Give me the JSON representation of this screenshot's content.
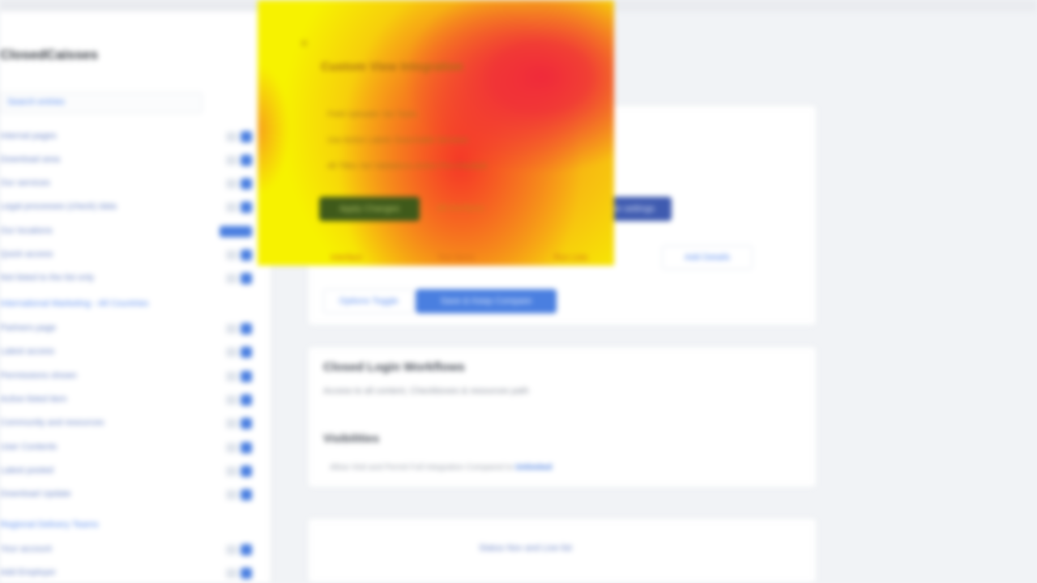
{
  "sidebar": {
    "title": "ClosedCaisses",
    "search_placeholder": "Search entries",
    "sections": [
      {
        "label": "International Marketing - All Countries"
      },
      {
        "label": "Regional Delivery Teams"
      }
    ],
    "items": [
      {
        "label": "Internal pages"
      },
      {
        "label": "Download area"
      },
      {
        "label": "Our services"
      },
      {
        "label": "Legal processes (check) data"
      },
      {
        "label": "Our locations"
      },
      {
        "label": "Quick access"
      },
      {
        "label": "Not listed to the list only"
      },
      {
        "label": "Partners page"
      },
      {
        "label": "Latest access"
      },
      {
        "label": "Permissions shown"
      },
      {
        "label": "Active listed item"
      },
      {
        "label": "Community and resources"
      },
      {
        "label": "User Contents"
      },
      {
        "label": "Latest posted"
      },
      {
        "label": "Download Update"
      },
      {
        "label": "Your account"
      },
      {
        "label": "Add Employer"
      }
    ]
  },
  "heat_card": {
    "title": "Custom View Integration",
    "lines": [
      "Field Uploader   Set Tasks",
      "Use Active Labels   Searchable Services",
      "All Titles Set   Validations Active   Pre-Checked"
    ],
    "primary_label": "Apply Changes",
    "middle_text": "All interfaces",
    "tabs": [
      "Interface",
      "Test Items",
      "Run Lists"
    ]
  },
  "main": {
    "card1": {
      "blue_button": "Save settings",
      "outline_button": "Add Details",
      "bottom_outline": "Options Toggle",
      "primary_button": "Save & Keep Compare"
    },
    "card2": {
      "title": "Closed Login Workflows",
      "subtitle": "Access to all content, Checkboxes & resources path",
      "heading": "Visibilities",
      "description": "Allow Visit and Permit Full Integration Compared to",
      "link": "Unlimited"
    },
    "card3": {
      "text": "Status  Nov and Live list"
    }
  },
  "colors": {
    "accent": "#4a7fe0",
    "heat_red": "#f02a3a",
    "heat_yellow": "#f7f200"
  }
}
